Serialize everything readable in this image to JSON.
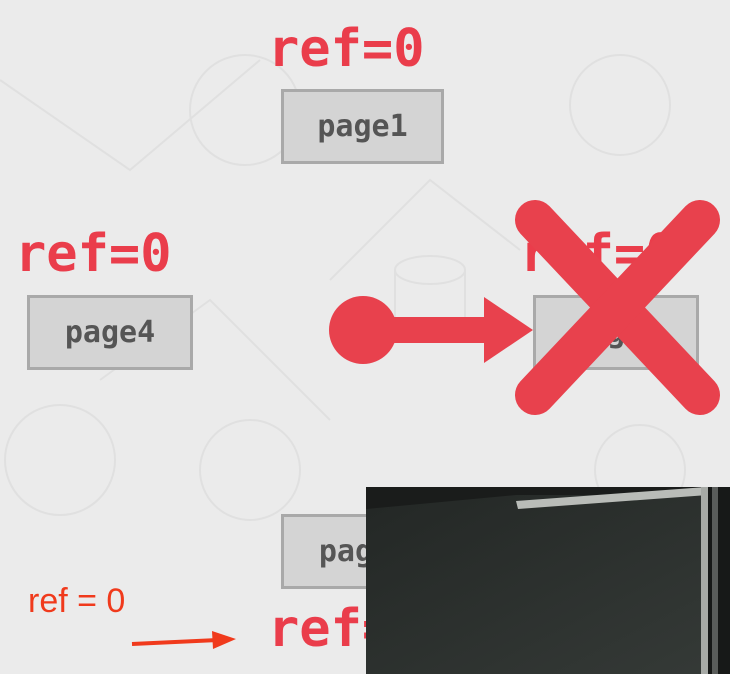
{
  "slide": {
    "node_top": {
      "ref": "ref=0",
      "page": "page1"
    },
    "node_left": {
      "ref": "ref=0",
      "page": "page4"
    },
    "node_right": {
      "ref": "ref=0",
      "page": "page3",
      "state": "crossed-out"
    },
    "node_bottom": {
      "ref": "ref=0",
      "page": "page2"
    },
    "pointer_arrow": {
      "icon": "clock-hand-arrow-icon",
      "color": "#e8414d"
    },
    "cross_mark": {
      "icon": "x-mark-icon",
      "color": "#e8414d"
    }
  },
  "annotation": {
    "text": "ref = 0",
    "color": "#f03a1c"
  },
  "video_inset": {
    "icon": "presenter-camera-feed"
  },
  "colors": {
    "background": "#ebebeb",
    "accent_red": "#ea3d4b",
    "page_fill": "#d4d4d4",
    "page_border": "#a9a9a9",
    "page_text": "#555555"
  }
}
